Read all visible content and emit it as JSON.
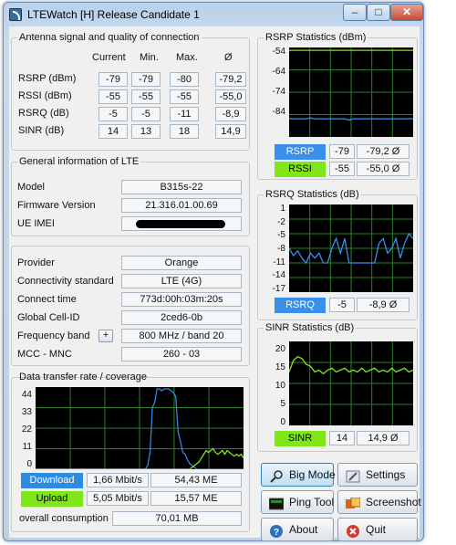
{
  "window": {
    "title": "LTEWatch [H]  Release Candidate 1",
    "min": "–",
    "max": "□",
    "close": "✕"
  },
  "antenna": {
    "title": "Antenna signal and quality of connection",
    "headers": [
      "Current",
      "Min.",
      "Max.",
      "Ø"
    ],
    "rows": [
      {
        "label": "RSRP (dBm)",
        "current": "-79",
        "min": "-79",
        "max": "-80",
        "avg": "-79,2"
      },
      {
        "label": "RSSI (dBm)",
        "current": "-55",
        "min": "-55",
        "max": "-55",
        "avg": "-55,0"
      },
      {
        "label": "RSRQ (dB)",
        "current": "-5",
        "min": "-5",
        "max": "-11",
        "avg": "-8,9"
      },
      {
        "label": "SINR (dB)",
        "current": "14",
        "min": "13",
        "max": "18",
        "avg": "14,9"
      }
    ]
  },
  "general": {
    "title": "General information of LTE",
    "model_label": "Model",
    "model": "B315s-22",
    "firmware_label": "Firmware Version",
    "firmware": "21.316.01.00.69",
    "imei_label": "UE IMEI"
  },
  "provider": {
    "provider_label": "Provider",
    "provider": "Orange",
    "standard_label": "Connectivity standard",
    "standard": "LTE (4G)",
    "time_label": "Connect time",
    "time": "773d:00h:03m:20s",
    "cell_label": "Global Cell-ID",
    "cell": "2ced6-0b",
    "band_label": "Frequency band",
    "band_btn": "+",
    "band": "800 MHz / band 20",
    "mcc_label": "MCC - MNC",
    "mcc": "260 - 03"
  },
  "transfer": {
    "title": "Data transfer rate / coverage",
    "yticks": [
      "44",
      "33",
      "22",
      "11",
      "0"
    ],
    "download_label": "Download",
    "download_rate": "1,66 Mbit/s",
    "download_total": "54,43 ME",
    "upload_label": "Upload",
    "upload_rate": "5,05 Mbit/s",
    "upload_total": "15,57 ME",
    "overall_label": "overall consumption",
    "overall": "70,01 MB"
  },
  "rsrp_stats": {
    "title": "RSRP Statistics (dBm)",
    "yticks": [
      "-54",
      "-64",
      "-74",
      "-84"
    ],
    "rsrp_label": "RSRP",
    "rsrp": "-79",
    "rsrp_avg": "-79,2 Ø",
    "rssi_label": "RSSI",
    "rssi": "-55",
    "rssi_avg": "-55,0 Ø"
  },
  "rsrq_stats": {
    "title": "RSRQ Statistics (dB)",
    "yticks": [
      "1",
      "-2",
      "-5",
      "-8",
      "-11",
      "-14",
      "-17"
    ],
    "label": "RSRQ",
    "value": "-5",
    "avg": "-8,9 Ø"
  },
  "sinr_stats": {
    "title": "SINR Statistics (dB)",
    "yticks": [
      "20",
      "15",
      "10",
      "5",
      "0"
    ],
    "label": "SINR",
    "value": "14",
    "avg": "14,9 Ø"
  },
  "buttons": {
    "bigmode": "Big Mode",
    "settings": "Settings",
    "ping": "Ping Tool",
    "screenshot": "Screenshot",
    "about": "About",
    "quit": "Quit"
  },
  "colors": {
    "download": "#2e8be0",
    "upload": "#7fe61a",
    "rsrp": "#3a8fe8",
    "rssi": "#7fe61a",
    "rsrq": "#3a8fe8",
    "sinr": "#7fe61a",
    "chart_bg": "#000000",
    "grid": "#2f7d2f"
  },
  "chart_data": [
    {
      "type": "line",
      "title": "RSRP Statistics (dBm)",
      "ylim": [
        -86,
        -54
      ],
      "series": [
        {
          "name": "RSRP",
          "values": [
            -79.5,
            -79.5,
            -79.5,
            -79.5,
            -79.5,
            -79.2,
            -79.5,
            -79.5,
            -79.5,
            -79.5,
            -79.5,
            -79.5,
            -79.5,
            -79.5,
            -80,
            -79.5,
            -79.5,
            -79.5,
            -79.5,
            -79.5,
            -79.5,
            -79.5,
            -79.5,
            -79.5,
            -79.5,
            -79.5,
            -79.5,
            -79.5,
            -79.5,
            -79.5
          ]
        },
        {
          "name": "RSSI",
          "values": [
            -55,
            -55,
            -55,
            -55,
            -55,
            -55,
            -55,
            -55,
            -55,
            -55,
            -55,
            -55,
            -55,
            -55,
            -55,
            -55,
            -55,
            -55,
            -55,
            -55,
            -55,
            -55,
            -55,
            -55,
            -55,
            -55,
            -55,
            -55,
            -55,
            -55
          ]
        }
      ]
    },
    {
      "type": "line",
      "title": "RSRQ Statistics (dB)",
      "ylim": [
        -17,
        1
      ],
      "series": [
        {
          "name": "RSRQ",
          "values": [
            -8,
            -9.5,
            -8.5,
            -10,
            -11,
            -9,
            -10,
            -9,
            -11,
            -11,
            -8,
            -6,
            -9,
            -6,
            -11,
            -11,
            -11,
            -11,
            -11,
            -11,
            -11,
            -7,
            -6,
            -9,
            -8,
            -6,
            -10,
            -7,
            -5,
            -6
          ]
        }
      ]
    },
    {
      "type": "line",
      "title": "SINR Statistics (dB)",
      "ylim": [
        0,
        22
      ],
      "series": [
        {
          "name": "SINR",
          "values": [
            14,
            17,
            18,
            17.5,
            16,
            15.5,
            14,
            14.5,
            13.5,
            14.5,
            15,
            14,
            14.5,
            15,
            14,
            14.5,
            14,
            15,
            14,
            14.5,
            15,
            14,
            14.5,
            14,
            15,
            14,
            14.5,
            15,
            14,
            14.5
          ]
        }
      ]
    },
    {
      "type": "line",
      "title": "Data transfer rate / coverage",
      "ylim": [
        0,
        44
      ],
      "series": [
        {
          "name": "Download",
          "values": [
            0,
            0,
            0,
            0,
            0,
            0,
            0,
            0,
            0,
            0,
            0,
            0,
            0,
            0,
            0,
            0,
            0,
            0,
            0,
            0,
            0,
            0,
            0,
            0,
            0,
            0,
            0,
            0,
            0,
            0,
            0,
            0,
            0,
            0,
            0,
            0,
            0,
            0,
            0,
            0,
            0,
            0,
            0,
            0,
            0,
            0,
            0,
            0,
            2,
            9,
            33,
            36,
            43,
            43,
            42,
            43,
            43,
            43,
            42,
            41,
            39,
            20,
            15,
            9,
            8,
            5,
            3,
            2,
            1,
            0,
            0,
            0,
            0,
            0,
            0,
            0,
            0,
            0,
            0,
            0,
            0,
            0,
            0,
            0,
            0,
            0,
            0,
            0,
            0,
            0
          ]
        },
        {
          "name": "Upload",
          "values": [
            0,
            0,
            0,
            0,
            0,
            0,
            0,
            0,
            0,
            0,
            0,
            0,
            0,
            0,
            0,
            0,
            0,
            0,
            0,
            0,
            0,
            0,
            0,
            0,
            0,
            0,
            0,
            0,
            0,
            0,
            0,
            0,
            0,
            0,
            0,
            0,
            0,
            0,
            0,
            0,
            0,
            0,
            0,
            0,
            0,
            0,
            0,
            0,
            0,
            0,
            0,
            0,
            0,
            0,
            0,
            0,
            0,
            0,
            0,
            0,
            0,
            0,
            0,
            0,
            0,
            0,
            0,
            1,
            2,
            3,
            4,
            6,
            8,
            10,
            9,
            10,
            11,
            9,
            8,
            9,
            10,
            8,
            10,
            9,
            8,
            7,
            8,
            7,
            8,
            6
          ]
        }
      ]
    }
  ]
}
